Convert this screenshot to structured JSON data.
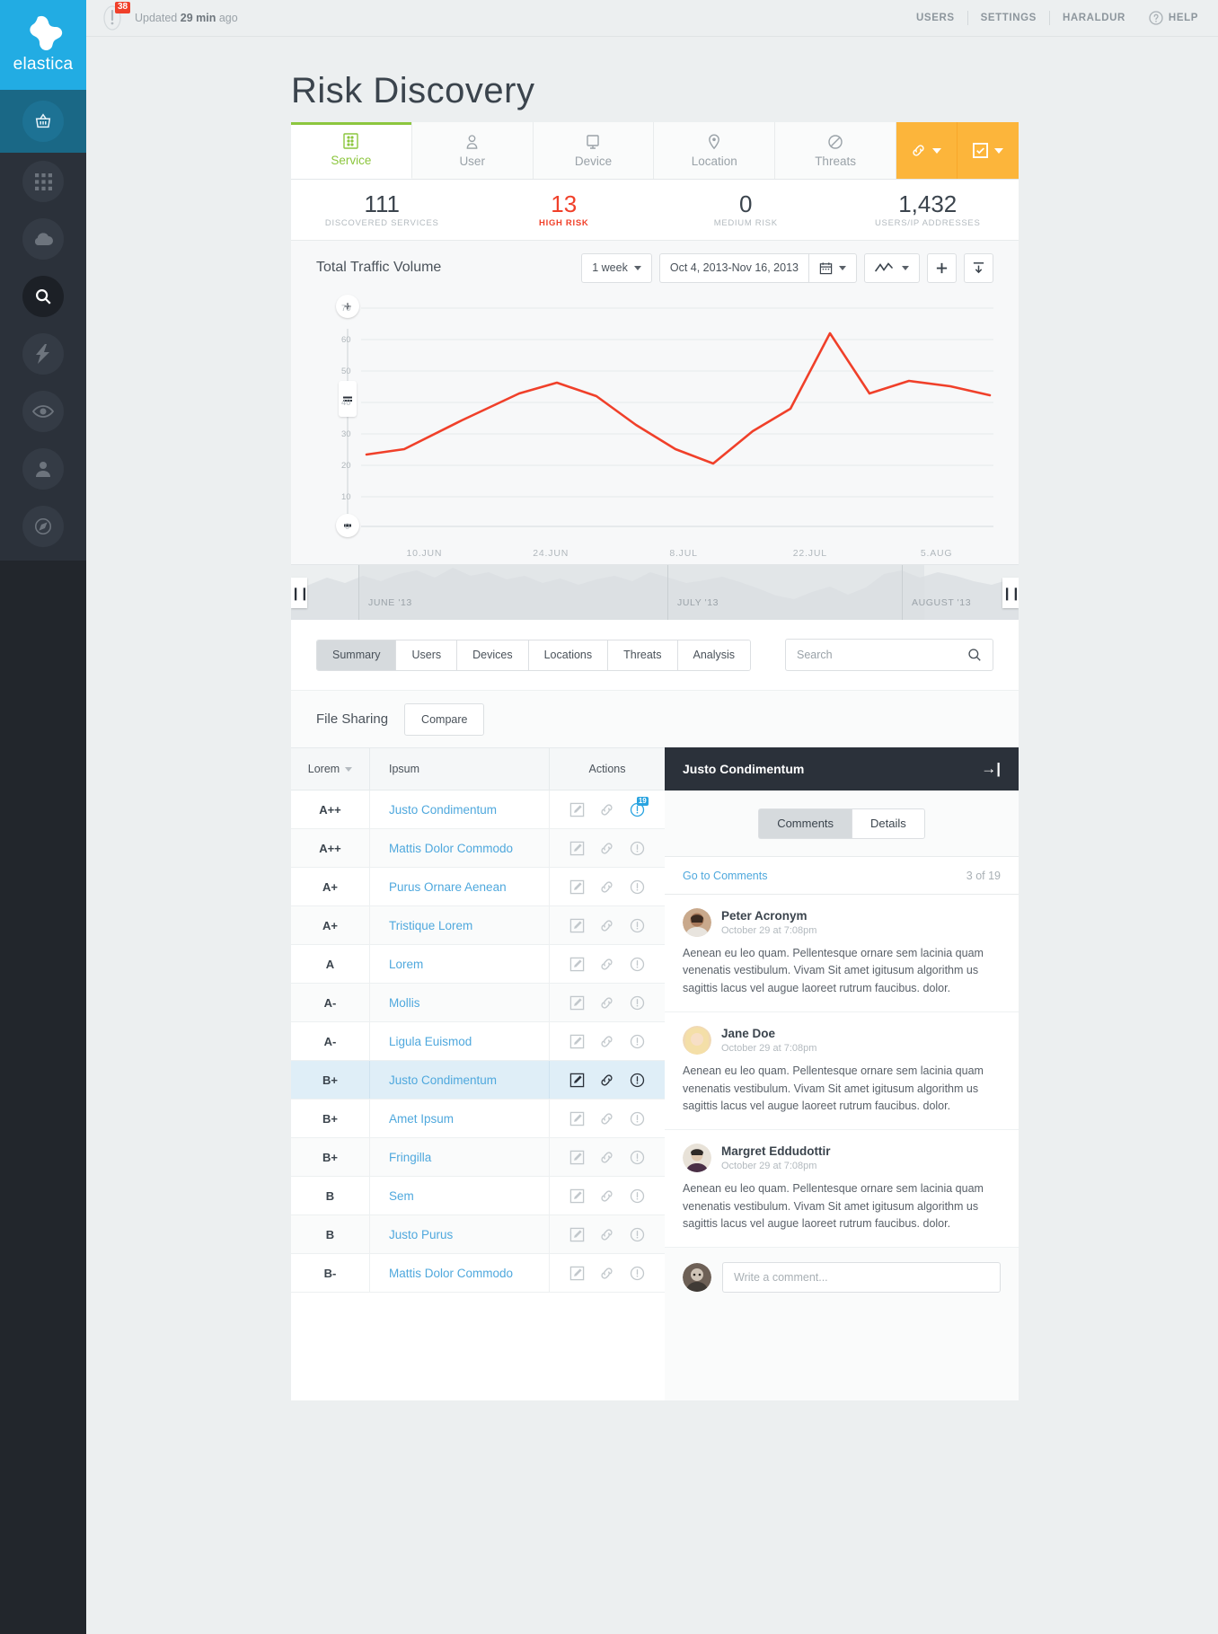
{
  "brand": {
    "name": "elastica",
    "logo_icon": "elastica-logo"
  },
  "sidebar": {
    "items": [
      {
        "icon": "basket-icon",
        "name": "sidebar-item-basket"
      },
      {
        "icon": "grid-icon",
        "name": "sidebar-item-apps"
      },
      {
        "icon": "cloud-icon",
        "name": "sidebar-item-cloud"
      },
      {
        "icon": "search-icon",
        "name": "sidebar-item-search"
      },
      {
        "icon": "bolt-icon",
        "name": "sidebar-item-activity"
      },
      {
        "icon": "eye-icon",
        "name": "sidebar-item-monitor"
      },
      {
        "icon": "user-icon",
        "name": "sidebar-item-user"
      },
      {
        "icon": "compass-icon",
        "name": "sidebar-item-explore"
      }
    ]
  },
  "topbar": {
    "alert_count": "38",
    "updated_prefix": "Updated",
    "updated_value": "29 min",
    "updated_suffix": "ago",
    "nav": [
      {
        "label": "USERS"
      },
      {
        "label": "SETTINGS"
      },
      {
        "label": "HARALDUR"
      }
    ],
    "help_label": "HELP",
    "help_icon": "question-circle-icon"
  },
  "page": {
    "title": "Risk Discovery"
  },
  "tabs": [
    {
      "label": "Service",
      "icon": "server-icon",
      "active": true
    },
    {
      "label": "User",
      "icon": "person-icon",
      "active": false
    },
    {
      "label": "Device",
      "icon": "monitor-icon",
      "active": false
    },
    {
      "label": "Location",
      "icon": "pin-icon",
      "active": false
    },
    {
      "label": "Threats",
      "icon": "ban-icon",
      "active": false
    }
  ],
  "tab_buttons": [
    {
      "icon": "link-icon",
      "name": "link-action-button"
    },
    {
      "icon": "checkbox-icon",
      "name": "check-action-button"
    }
  ],
  "stats": [
    {
      "value": "111",
      "label": "DISCOVERED SERVICES",
      "risk": false
    },
    {
      "value": "13",
      "label": "HIGH RISK",
      "risk": true
    },
    {
      "value": "0",
      "label": "MEDIUM RISK",
      "risk": false
    },
    {
      "value": "1,432",
      "label": "USERS/IP ADDRESSES",
      "risk": false
    }
  ],
  "chart_panel": {
    "title": "Total Traffic Volume",
    "range_select": "1 week",
    "date_range": "Oct 4, 2013-Nov 16, 2013",
    "calendar_icon": "calendar-icon",
    "chart_type_icon": "line-chart-icon",
    "add_icon": "plus-icon",
    "export_icon": "download-icon"
  },
  "zoom_control": {
    "plus": "+",
    "minus": "–",
    "handle": "="
  },
  "chart_data": {
    "type": "line",
    "title": "Total Traffic Volume",
    "xlabel": "",
    "ylabel": "",
    "grid": true,
    "legend": "none",
    "series_color": "#f0402a",
    "ylim": [
      0,
      75
    ],
    "yticks": [
      0,
      10,
      20,
      30,
      40,
      50,
      60,
      70
    ],
    "xticks": [
      "10.JUN",
      "24.JUN",
      "8.JUL",
      "22.JUL",
      "5.AUG"
    ],
    "x": [
      0,
      1,
      2,
      3,
      4,
      5,
      6,
      7,
      8,
      9,
      10,
      11,
      12,
      13,
      14
    ],
    "values": [
      23,
      24,
      32,
      41,
      45,
      41,
      33,
      26,
      20,
      30,
      38,
      59,
      41,
      46,
      44,
      40
    ]
  },
  "brush": {
    "months": [
      "JUNE '13",
      "JULY '13",
      "AUGUST '13"
    ],
    "handle_glyph": "❙❙"
  },
  "subtabs": [
    {
      "label": "Summary",
      "active": true
    },
    {
      "label": "Users",
      "active": false
    },
    {
      "label": "Devices",
      "active": false
    },
    {
      "label": "Locations",
      "active": false
    },
    {
      "label": "Threats",
      "active": false
    },
    {
      "label": "Analysis",
      "active": false
    }
  ],
  "search": {
    "placeholder": "Search",
    "value": "",
    "icon": "search-icon"
  },
  "section": {
    "title": "File Sharing",
    "compare_label": "Compare"
  },
  "table": {
    "columns": [
      "Lorem",
      "Ipsum",
      "Actions"
    ],
    "rows": [
      {
        "grade": "A++",
        "name": "Justo Condimentum",
        "selected": false,
        "badge": "19"
      },
      {
        "grade": "A++",
        "name": "Mattis Dolor Commodo",
        "selected": false,
        "badge": ""
      },
      {
        "grade": "A+",
        "name": "Purus Ornare Aenean",
        "selected": false,
        "badge": ""
      },
      {
        "grade": "A+",
        "name": "Tristique Lorem",
        "selected": false,
        "badge": ""
      },
      {
        "grade": "A",
        "name": "Lorem",
        "selected": false,
        "badge": ""
      },
      {
        "grade": "A-",
        "name": "Mollis",
        "selected": false,
        "badge": ""
      },
      {
        "grade": "A-",
        "name": "Ligula Euismod",
        "selected": false,
        "badge": ""
      },
      {
        "grade": "B+",
        "name": "Justo Condimentum",
        "selected": true,
        "badge": ""
      },
      {
        "grade": "B+",
        "name": "Amet Ipsum",
        "selected": false,
        "badge": ""
      },
      {
        "grade": "B+",
        "name": "Fringilla",
        "selected": false,
        "badge": ""
      },
      {
        "grade": "B",
        "name": "Sem",
        "selected": false,
        "badge": ""
      },
      {
        "grade": "B",
        "name": "Justo Purus",
        "selected": false,
        "badge": ""
      },
      {
        "grade": "B-",
        "name": "Mattis Dolor Commodo",
        "selected": false,
        "badge": ""
      }
    ],
    "row_icons": [
      "edit-icon",
      "link-icon",
      "info-icon"
    ]
  },
  "details_panel": {
    "title": "Justo Condimentum",
    "collapse_icon": "collapse-right-icon",
    "tabs": [
      {
        "label": "Comments",
        "active": true
      },
      {
        "label": "Details",
        "active": false
      }
    ],
    "go_to_comments": "Go to Comments",
    "count": "3 of 19",
    "comments": [
      {
        "author": "Peter Acronym",
        "time": "October 29 at 7:08pm",
        "text": "Aenean eu leo quam. Pellentesque ornare sem lacinia quam venenatis vestibulum. Vivam Sit amet igitusum algorithm us sagittis lacus vel augue laoreet rutrum faucibus. dolor.",
        "avatar": "avatar-peter"
      },
      {
        "author": "Jane Doe",
        "time": "October 29 at 7:08pm",
        "text": "Aenean eu leo quam. Pellentesque ornare sem lacinia quam venenatis vestibulum. Vivam Sit amet igitusum algorithm us sagittis lacus vel augue laoreet rutrum faucibus. dolor.",
        "avatar": "avatar-jane"
      },
      {
        "author": "Margret Eddudottir",
        "time": "October 29 at 7:08pm",
        "text": "Aenean eu leo quam. Pellentesque ornare sem lacinia quam venenatis vestibulum. Vivam Sit amet igitusum algorithm us sagittis lacus vel augue laoreet rutrum faucibus. dolor.",
        "avatar": "avatar-margret"
      }
    ],
    "composer": {
      "placeholder": "Write a comment...",
      "value": "",
      "avatar": "avatar-current-user"
    }
  },
  "colors": {
    "brand_blue": "#22ace3",
    "accent_green": "#8cc63e",
    "risk_red": "#f0402a",
    "orange": "#fcb53b",
    "link_blue": "#4fa8dd",
    "dark": "#2b313a"
  }
}
